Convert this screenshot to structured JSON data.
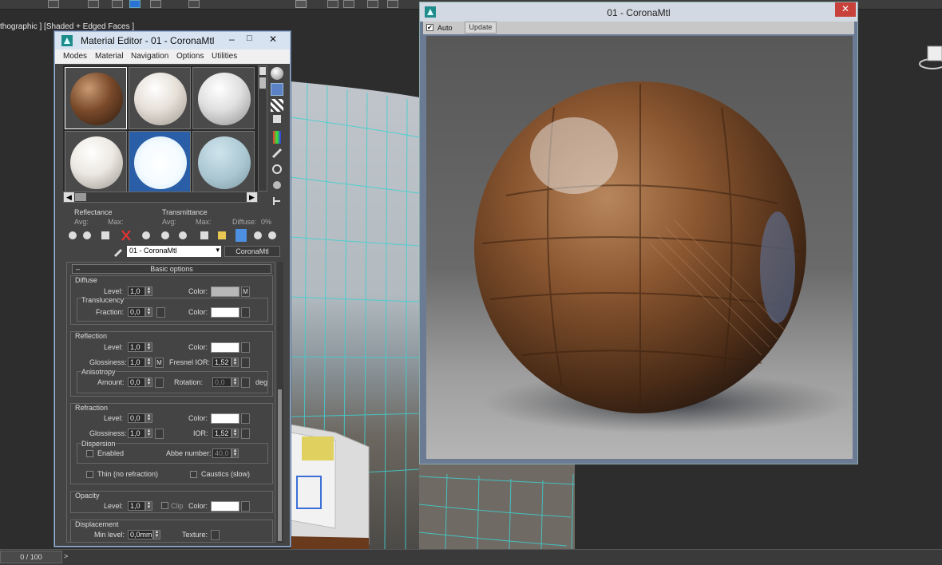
{
  "viewport": {
    "label": "thographic ] [Shaded + Edged Faces ]"
  },
  "material_editor": {
    "title": "Material Editor - 01 - CoronaMtl",
    "menu": [
      "Modes",
      "Material",
      "Navigation",
      "Options",
      "Utilities"
    ],
    "reflectance": {
      "label": "Reflectance",
      "avg": "Avg:",
      "max": "Max:"
    },
    "transmittance": {
      "label": "Transmittance",
      "avg": "Avg:",
      "max": "Max:",
      "diffuse": "Diffuse:",
      "diffuse_val": "0%"
    },
    "material_name": "01 - CoronaMtl",
    "material_type": "CoronaMtl",
    "rollout_title": "Basic options",
    "diffuse": {
      "header": "Diffuse",
      "level_label": "Level:",
      "level": "1,0",
      "color_label": "Color:",
      "color": "#b8b8b8",
      "map_btn": "M",
      "translucency_header": "Translucency",
      "fraction_label": "Fraction:",
      "fraction": "0,0",
      "t_color_label": "Color:",
      "t_color": "#ffffff"
    },
    "reflection": {
      "header": "Reflection",
      "level_label": "Level:",
      "level": "1,0",
      "color_label": "Color:",
      "color": "#ffffff",
      "gloss_label": "Glossiness:",
      "gloss": "1,0",
      "gloss_map": "M",
      "fresnel_label": "Fresnel IOR:",
      "fresnel": "1,52",
      "aniso_header": "Anisotropy",
      "amount_label": "Amount:",
      "amount": "0,0",
      "rotation_label": "Rotation:",
      "rotation": "0,0",
      "deg": "deg"
    },
    "refraction": {
      "header": "Refraction",
      "level_label": "Level:",
      "level": "0,0",
      "color_label": "Color:",
      "color": "#ffffff",
      "gloss_label": "Glossiness:",
      "gloss": "1,0",
      "ior_label": "IOR:",
      "ior": "1,52",
      "dispersion_header": "Dispersion",
      "enabled_label": "Enabled",
      "abbe_label": "Abbe number:",
      "abbe": "40,0",
      "thin_label": "Thin (no refraction)",
      "caustics_label": "Caustics (slow)"
    },
    "opacity": {
      "header": "Opacity",
      "level_label": "Level:",
      "level": "1,0",
      "clip_label": "Clip",
      "color_label": "Color:",
      "color": "#ffffff"
    },
    "displacement": {
      "header": "Displacement",
      "min_label": "Min level:",
      "min": "0,0mm",
      "texture_label": "Texture:"
    }
  },
  "preview": {
    "title": "01 - CoronaMtl",
    "auto_label": "Auto",
    "update_label": "Update"
  },
  "timeline": {
    "frame": "0 / 100",
    "next": ">"
  },
  "colors": {
    "accent": "#2b73d6",
    "close_red": "#c8413b",
    "wire_cyan": "#3fd0d0"
  }
}
